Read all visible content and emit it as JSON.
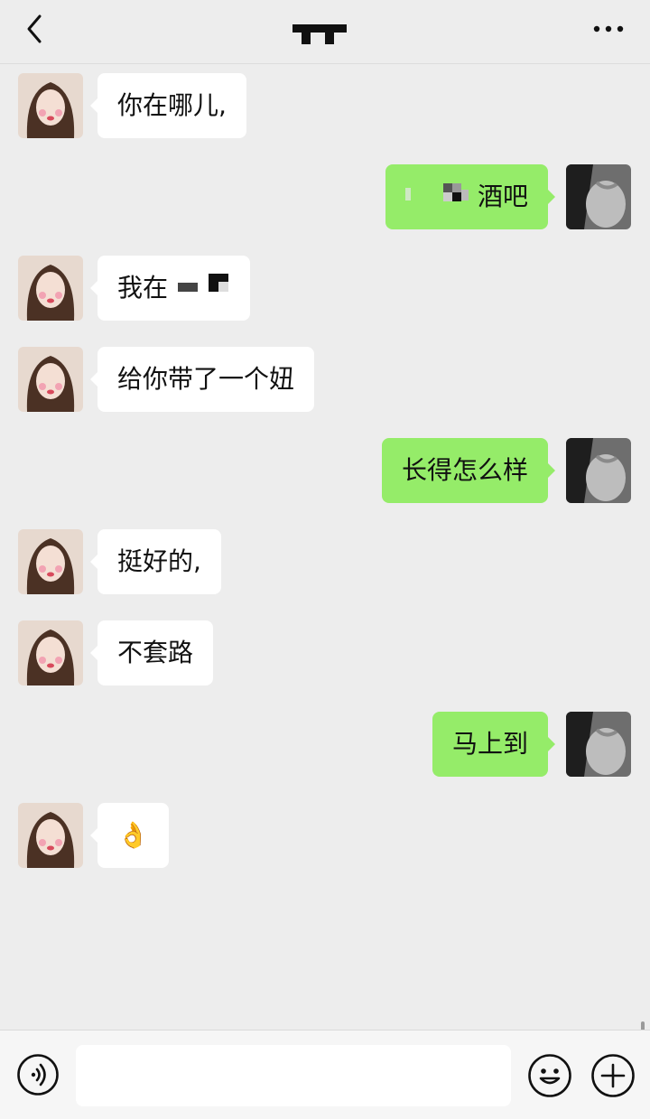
{
  "header": {
    "back_icon": "chevron-left-icon",
    "more_icon": "more-dots-icon"
  },
  "messages": [
    {
      "side": "left",
      "text": "你在哪儿,"
    },
    {
      "side": "right",
      "text": "酒吧"
    },
    {
      "side": "left",
      "text": "我在"
    },
    {
      "side": "left",
      "text": "给你带了一个妞"
    },
    {
      "side": "right",
      "text": "长得怎么样"
    },
    {
      "side": "left",
      "text": "挺好的,"
    },
    {
      "side": "left",
      "text": "不套路"
    },
    {
      "side": "right",
      "text": "马上到"
    },
    {
      "side": "left",
      "text": "👌"
    }
  ],
  "input": {
    "value": "",
    "voice_icon": "voice-icon",
    "emoji_icon": "emoji-icon",
    "plus_icon": "plus-icon"
  },
  "colors": {
    "background": "#ededed",
    "incoming_bubble": "#ffffff",
    "outgoing_bubble": "#95ec69"
  }
}
